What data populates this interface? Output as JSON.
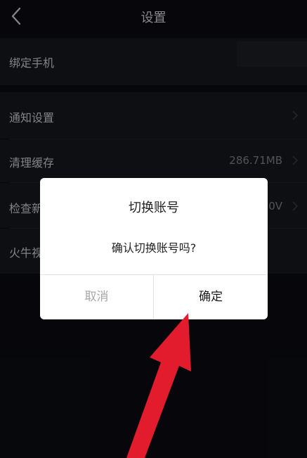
{
  "header": {
    "title": "设置",
    "back_icon": "chevron-left-icon"
  },
  "settings": {
    "bind_phone": {
      "label": "绑定手机"
    },
    "notifications": {
      "label": "通知设置"
    },
    "clear_cache": {
      "label": "清理缓存",
      "value": "286.71MB"
    },
    "check_update": {
      "label": "检查新",
      "value": "0V"
    },
    "partial_row": {
      "label": "火牛视"
    }
  },
  "dialog": {
    "title": "切换账号",
    "message": "确认切换账号吗?",
    "cancel_label": "取消",
    "confirm_label": "确定"
  },
  "colors": {
    "background": "#0b0c11",
    "row_background": "#16171c",
    "dialog_background": "#ffffff",
    "arrow": "#e21b2d"
  }
}
